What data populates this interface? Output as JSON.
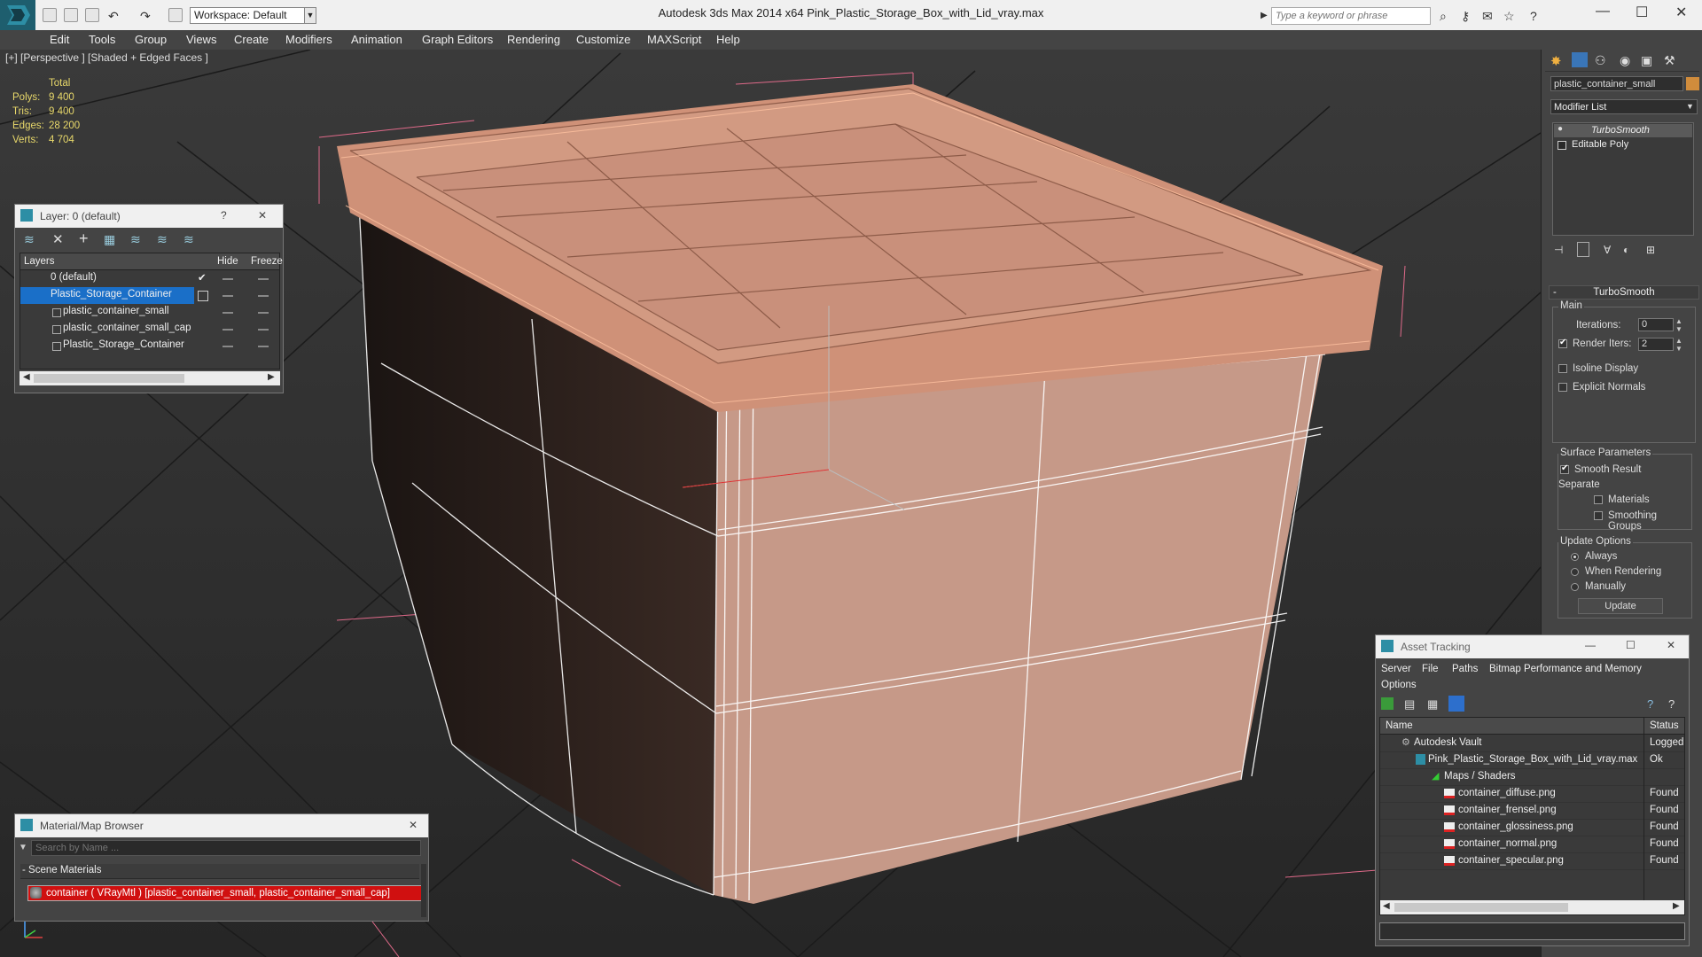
{
  "title_bar": {
    "workspace": "Workspace: Default",
    "app_title": "Autodesk 3ds Max  2014 x64      Pink_Plastic_Storage_Box_with_Lid_vray.max",
    "search_placeholder": "Type a keyword or phrase"
  },
  "menu": [
    "Edit",
    "Tools",
    "Group",
    "Views",
    "Create",
    "Modifiers",
    "Animation",
    "Graph Editors",
    "Rendering",
    "Customize",
    "MAXScript",
    "Help"
  ],
  "viewport": {
    "label": "[+] [Perspective ] [Shaded + Edged Faces ]",
    "stats": {
      "header": "Total",
      "rows": [
        {
          "label": "Polys:",
          "value": "9 400"
        },
        {
          "label": "Tris:",
          "value": "9 400"
        },
        {
          "label": "Edges:",
          "value": "28 200"
        },
        {
          "label": "Verts:",
          "value": "4 704"
        }
      ]
    },
    "colors": {
      "box": "#c69988",
      "lid": "#d29a82",
      "wire": "#ffffff",
      "ground": "#2a2a2a"
    }
  },
  "layer_panel": {
    "title": "Layer: 0 (default)",
    "help": "?",
    "close": "✕",
    "columns": [
      "Layers",
      "Hide",
      "Freeze"
    ],
    "rows": [
      {
        "name": "0 (default)",
        "check": "✔"
      },
      {
        "name": "Plastic_Storage_Container"
      },
      {
        "name": "plastic_container_small"
      },
      {
        "name": "plastic_container_small_cap"
      },
      {
        "name": "Plastic_Storage_Container"
      }
    ]
  },
  "material_browser": {
    "title": "Material/Map Browser",
    "close": "✕",
    "search_placeholder": "Search by Name ...",
    "section": "- Scene Materials",
    "item": "container ( VRayMtl ) [plastic_container_small, plastic_container_small_cap]"
  },
  "command_panel": {
    "object_name": "plastic_container_small",
    "modifier_list": "Modifier List",
    "stack": [
      "TurboSmooth",
      "Editable Poly"
    ],
    "rollout_title": "TurboSmooth",
    "main_group": "Main",
    "iterations_label": "Iterations:",
    "iterations_value": "0",
    "render_iters_label": "Render Iters:",
    "render_iters_value": "2",
    "isoline": "Isoline Display",
    "explicit_normals": "Explicit Normals",
    "surface_group": "Surface Parameters",
    "smooth_result": "Smooth Result",
    "separate": "Separate",
    "materials": "Materials",
    "smoothing_groups": "Smoothing Groups",
    "update_group": "Update Options",
    "always": "Always",
    "when_rendering": "When Rendering",
    "manually": "Manually",
    "update_button": "Update",
    "accent": "#d08c3c"
  },
  "asset_tracking": {
    "title": "Asset Tracking",
    "menus": [
      "Server",
      "File",
      "Paths",
      "Bitmap Performance and Memory",
      "Options"
    ],
    "columns": [
      "Name",
      "Status"
    ],
    "rows": [
      {
        "name": "Autodesk Vault",
        "status": "Logged"
      },
      {
        "name": "Pink_Plastic_Storage_Box_with_Lid_vray.max",
        "status": "Ok"
      },
      {
        "name": "Maps / Shaders",
        "status": ""
      },
      {
        "name": "container_diffuse.png",
        "status": "Found"
      },
      {
        "name": "container_frensel.png",
        "status": "Found"
      },
      {
        "name": "container_glossiness.png",
        "status": "Found"
      },
      {
        "name": "container_normal.png",
        "status": "Found"
      },
      {
        "name": "container_specular.png",
        "status": "Found"
      }
    ]
  }
}
